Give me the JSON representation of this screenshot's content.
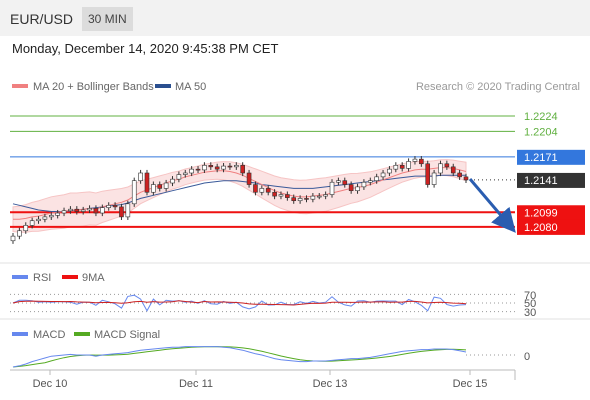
{
  "header": {
    "pair": "EUR/USD",
    "timeframe": "30 MIN"
  },
  "timestamp": "Monday, December 14, 2020 9:45:38 PM CET",
  "legend": {
    "ma20": "MA 20 + Bollinger Bands",
    "ma50": "MA 50",
    "credit": "Research © 2020 Trading Central"
  },
  "colors": {
    "bull": "#60b040",
    "candle": "#cc2222",
    "resistance_blue": "#3377dd",
    "support_red": "#ee1111",
    "bb": "#f6b8b8",
    "ma50": "#3a5a9a",
    "rsi": "#6688ee",
    "macd": "#6688ee",
    "macd_signal": "#55aa22"
  },
  "chart_data": [
    {
      "type": "candlestick",
      "title": "EUR/USD 30 MIN",
      "x_ticks": [
        "Dec 10",
        "Dec 11",
        "Dec 13",
        "Dec 15"
      ],
      "ylim": [
        1.205,
        1.225
      ],
      "levels": [
        {
          "value": 1.2224,
          "label": "1.2224",
          "color": "#60b040"
        },
        {
          "value": 1.2204,
          "label": "1.2204",
          "color": "#60b040"
        },
        {
          "value": 1.2171,
          "label": "1.2171",
          "color": "#3377dd"
        },
        {
          "value": 1.2141,
          "label": "1.2141",
          "color": "#333333"
        },
        {
          "value": 1.2099,
          "label": "1.2099",
          "color": "#ee1111"
        },
        {
          "value": 1.208,
          "label": "1.2080",
          "color": "#ee1111"
        }
      ],
      "last_price": 1.2141,
      "close": [
        1.2068,
        1.2075,
        1.2082,
        1.2088,
        1.209,
        1.2093,
        1.2095,
        1.2098,
        1.2101,
        1.2103,
        1.21,
        1.2102,
        1.2104,
        1.2098,
        1.2105,
        1.2108,
        1.2106,
        1.2093,
        1.211,
        1.214,
        1.215,
        1.2125,
        1.2135,
        1.213,
        1.2137,
        1.2142,
        1.2148,
        1.215,
        1.2155,
        1.2154,
        1.216,
        1.2158,
        1.2155,
        1.2159,
        1.2158,
        1.216,
        1.215,
        1.2135,
        1.2125,
        1.213,
        1.2125,
        1.212,
        1.2122,
        1.2118,
        1.2114,
        1.2117,
        1.2116,
        1.212,
        1.212,
        1.2122,
        1.2138,
        1.214,
        1.2135,
        1.2127,
        1.2132,
        1.2138,
        1.214,
        1.2145,
        1.215,
        1.2155,
        1.216,
        1.2156,
        1.2165,
        1.2168,
        1.2162,
        1.2135,
        1.215,
        1.2162,
        1.2158,
        1.215,
        1.2145,
        1.2141
      ],
      "ma20": [
        1.209,
        1.209,
        1.2091,
        1.2093,
        1.2094,
        1.2096,
        1.2098,
        1.2099,
        1.21,
        1.2102,
        1.2102,
        1.2103,
        1.2104,
        1.2103,
        1.2106,
        1.2108,
        1.211,
        1.2112,
        1.2115,
        1.212,
        1.2125,
        1.2128,
        1.2131,
        1.2134,
        1.2137,
        1.214,
        1.2142,
        1.2145,
        1.2147,
        1.2149,
        1.2151,
        1.2152,
        1.2153,
        1.2153,
        1.2152,
        1.215,
        1.2147,
        1.2143,
        1.2139,
        1.2135,
        1.2131,
        1.2127,
        1.2124,
        1.2122,
        1.212,
        1.2119,
        1.2119,
        1.212,
        1.2121,
        1.2122,
        1.2124,
        1.2126,
        1.2128,
        1.213,
        1.2131,
        1.2133,
        1.2135,
        1.2138,
        1.2141,
        1.2144,
        1.2147,
        1.215,
        1.2152,
        1.2154,
        1.2155,
        1.2155,
        1.2156,
        1.2157,
        1.2157,
        1.2156,
        1.2154,
        1.2152
      ],
      "ma50": [
        1.211,
        1.2108,
        1.2106,
        1.2104,
        1.2102,
        1.2101,
        1.21,
        1.21,
        1.21,
        1.2101,
        1.2102,
        1.2103,
        1.2104,
        1.2105,
        1.2106,
        1.2107,
        1.2108,
        1.2109,
        1.2111,
        1.2114,
        1.2117,
        1.2119,
        1.2121,
        1.2123,
        1.2125,
        1.2127,
        1.2129,
        1.2131,
        1.2133,
        1.2135,
        1.2137,
        1.2138,
        1.2139,
        1.214,
        1.214,
        1.214,
        1.2139,
        1.2138,
        1.2137,
        1.2135,
        1.2134,
        1.2133,
        1.2132,
        1.2131,
        1.213,
        1.213,
        1.213,
        1.213,
        1.2131,
        1.2132,
        1.2133,
        1.2134,
        1.2135,
        1.2136,
        1.2137,
        1.2138,
        1.2139,
        1.214,
        1.2141,
        1.2142,
        1.2143,
        1.2144,
        1.2145,
        1.2146,
        1.2146,
        1.2146,
        1.2146,
        1.2147,
        1.2147,
        1.2147,
        1.2147,
        1.2147
      ]
    },
    {
      "type": "line",
      "title": "RSI",
      "series": [
        {
          "name": "RSI"
        },
        {
          "name": "9MA"
        }
      ],
      "y_ticks": [
        70,
        50,
        30
      ],
      "ylim": [
        20,
        80
      ]
    },
    {
      "type": "line",
      "title": "MACD",
      "series": [
        {
          "name": "MACD"
        },
        {
          "name": "MACD Signal"
        }
      ],
      "y_ticks": [
        0
      ]
    }
  ]
}
